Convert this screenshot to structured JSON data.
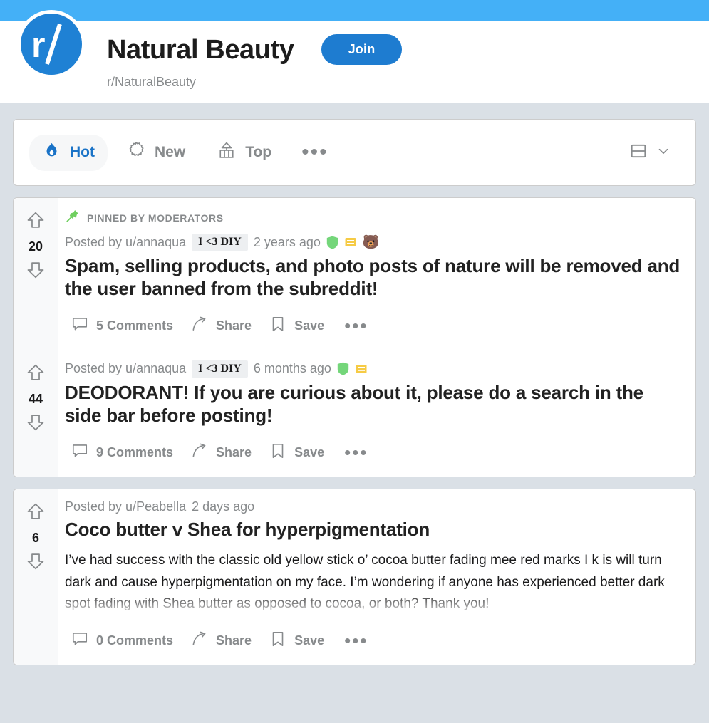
{
  "header": {
    "banner_color": "#44b0f7",
    "avatar_icon": "reddit-snoo-r-slash-logo",
    "title": "Natural Beauty",
    "join_label": "Join",
    "handle": "r/NaturalBeauty",
    "accent_color": "#1e7cd0"
  },
  "sortbar": {
    "items": [
      {
        "label": "Hot",
        "icon": "flame-icon",
        "active": true
      },
      {
        "label": "New",
        "icon": "starburst-icon",
        "active": false
      },
      {
        "label": "Top",
        "icon": "chart-arrow-icon",
        "active": false
      }
    ],
    "more_label": "•••",
    "view_icon": "card-view-icon",
    "view_chevron_icon": "chevron-down-icon"
  },
  "posts": [
    {
      "pinned": true,
      "pinned_label": "PINNED BY MODERATORS",
      "pin_icon": "pin-icon",
      "score": "20",
      "posted_by": "Posted by u/annaqua",
      "flair": "I <3 DIY",
      "timestamp": "2 years ago",
      "badges": [
        "green-shield-badge",
        "yellow-card-badge",
        "bear-emoji-badge"
      ],
      "title": "Spam, selling products, and photo posts of nature will be removed and the user banned from the subreddit!",
      "body": "",
      "comments_label": "5 Comments",
      "share_label": "Share",
      "save_label": "Save"
    },
    {
      "pinned": false,
      "pinned_label": "",
      "pin_icon": "",
      "score": "44",
      "posted_by": "Posted by u/annaqua",
      "flair": "I <3 DIY",
      "timestamp": "6 months ago",
      "badges": [
        "green-shield-badge",
        "yellow-card-badge"
      ],
      "title": "DEODORANT! If you are curious about it, please do a search in the side bar before posting!",
      "body": "",
      "comments_label": "9 Comments",
      "share_label": "Share",
      "save_label": "Save"
    },
    {
      "pinned": false,
      "pinned_label": "",
      "pin_icon": "",
      "score": "6",
      "posted_by": "Posted by u/Peabella",
      "flair": "",
      "timestamp": "2 days ago",
      "badges": [],
      "title": "Coco butter v Shea for hyperpigmentation",
      "body": "I’ve had success with the classic old yellow stick o’ cocoa butter fading mee red marks I k is will turn dark and cause hyperpigmentation on my face. I’m wondering if anyone has experienced better dark spot fading with Shea butter as opposed to cocoa, or both? Thank you!",
      "comments_label": "0 Comments",
      "share_label": "Share",
      "save_label": "Save"
    }
  ],
  "action_more_label": "•••"
}
